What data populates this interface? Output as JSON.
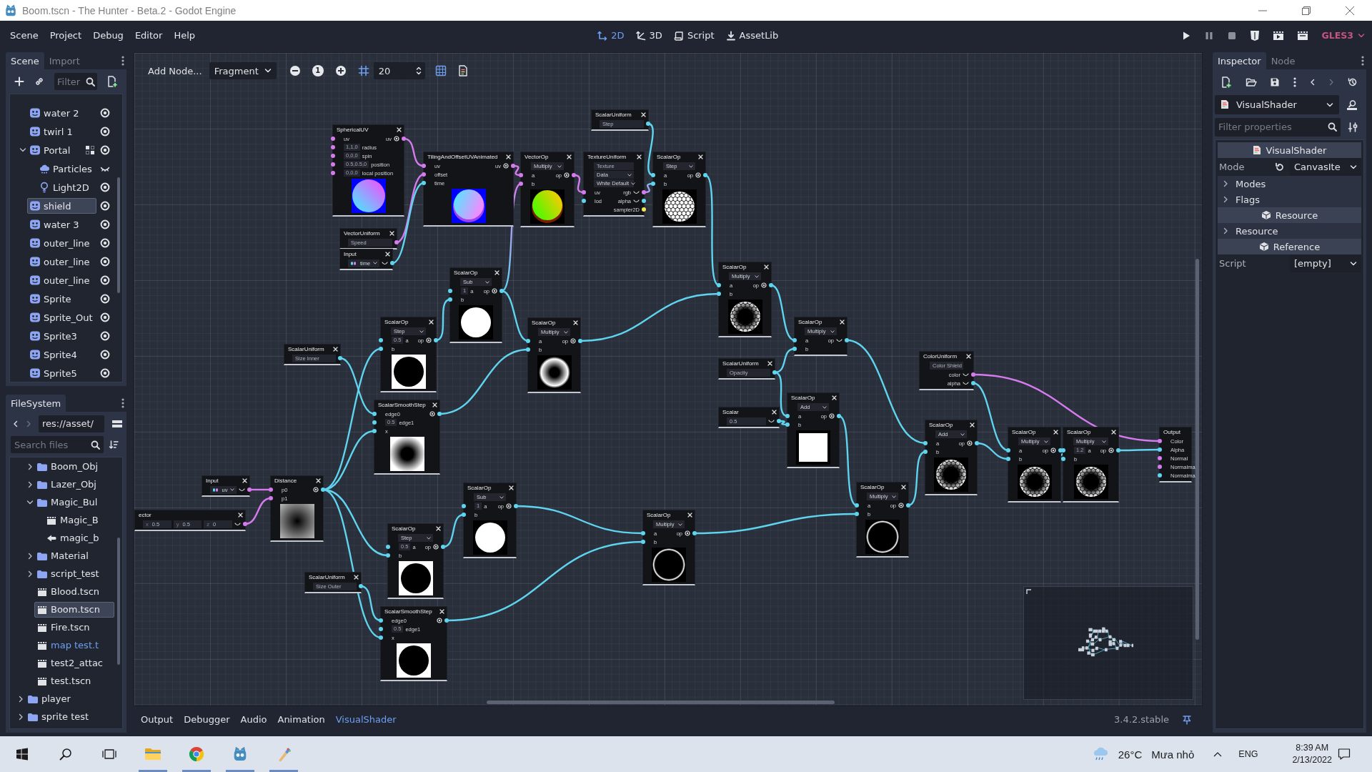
{
  "window": {
    "title": "Boom.tscn - The Hunter - Beta.2 - Godot Engine"
  },
  "menu": [
    "Scene",
    "Project",
    "Debug",
    "Editor",
    "Help"
  ],
  "workspaces": [
    {
      "label": "2D",
      "kind": "canvas",
      "selected": true
    },
    {
      "label": "3D",
      "kind": "spatial",
      "selected": false
    },
    {
      "label": "Script",
      "kind": "script",
      "selected": false
    },
    {
      "label": "AssetLib",
      "kind": "assetlib",
      "selected": false
    }
  ],
  "run_buttons": [
    {
      "kind": "play",
      "disabled": false
    },
    {
      "kind": "pause",
      "disabled": true
    },
    {
      "kind": "stop",
      "disabled": true
    },
    {
      "kind": "html5",
      "disabled": false
    },
    {
      "kind": "playscene",
      "disabled": false
    },
    {
      "kind": "playcustom",
      "disabled": false
    }
  ],
  "renderer": "GLES3",
  "scene_dock": {
    "tabs": [
      {
        "label": "Scene",
        "selected": true
      },
      {
        "label": "Import",
        "selected": false
      }
    ],
    "filter": {
      "placeholder": "Filter"
    },
    "tree": [
      {
        "label": "water 2",
        "kind": "sprite",
        "in_group": false,
        "visible": true,
        "selected": false
      },
      {
        "label": "twirl 1",
        "kind": "sprite",
        "in_group": false,
        "visible": true,
        "selected": false
      },
      {
        "label": "Portal",
        "kind": "sprite",
        "in_group": true,
        "visible": true,
        "selected": false,
        "expanded": true,
        "children": [
          {
            "label": "Particles",
            "kind": "particles",
            "in_group": false,
            "visible": false,
            "selected": false
          },
          {
            "label": "Light2D",
            "kind": "light",
            "in_group": false,
            "visible": true,
            "selected": false
          }
        ]
      },
      {
        "label": "shield",
        "kind": "sprite",
        "in_group": false,
        "visible": true,
        "selected": true
      },
      {
        "label": "water 3",
        "kind": "sprite",
        "in_group": false,
        "visible": true,
        "selected": false
      },
      {
        "label": "outer_line",
        "kind": "sprite",
        "in_group": false,
        "visible": true,
        "selected": false
      },
      {
        "label": "outer_line",
        "kind": "sprite",
        "in_group": false,
        "visible": true,
        "selected": false
      },
      {
        "label": "outer_line",
        "kind": "sprite",
        "in_group": false,
        "visible": true,
        "selected": false
      },
      {
        "label": "Sprite",
        "kind": "sprite",
        "in_group": false,
        "visible": true,
        "selected": false
      },
      {
        "label": "Sprite_Out",
        "kind": "sprite",
        "in_group": false,
        "visible": true,
        "selected": false
      },
      {
        "label": "Sprite3",
        "kind": "sprite",
        "in_group": false,
        "visible": true,
        "selected": false
      },
      {
        "label": "Sprite4",
        "kind": "sprite",
        "in_group": false,
        "visible": true,
        "selected": false
      },
      {
        "label": "Sprite5",
        "kind": "sprite",
        "in_group": false,
        "visible": true,
        "selected": false
      }
    ]
  },
  "filesystem_dock": {
    "tabs": [
      {
        "label": "FileSystem",
        "selected": true
      }
    ],
    "path": "res://asset/",
    "search": {
      "placeholder": "Search files"
    },
    "tree": [
      {
        "children": [
          {
            "label": "Boom_Obj",
            "kind": "folder",
            "expanded": false,
            "selected": false,
            "highlighted": false
          },
          {
            "label": "Lazer_Obj",
            "kind": "folder",
            "expanded": false,
            "selected": false,
            "highlighted": false
          },
          {
            "label": "Magic_Bul",
            "kind": "folder",
            "expanded": true,
            "selected": false,
            "highlighted": false,
            "children": [
              {
                "label": "Magic_B",
                "kind": "scene",
                "selected": false,
                "highlighted": false
              },
              {
                "label": "magic_b",
                "kind": "resource",
                "selected": false,
                "highlighted": false
              }
            ]
          },
          {
            "label": "Material",
            "kind": "folder",
            "expanded": false,
            "selected": false,
            "highlighted": false
          },
          {
            "label": "script_test",
            "kind": "folder",
            "expanded": false,
            "selected": false,
            "highlighted": false
          },
          {
            "label": "Blood.tscn",
            "kind": "scene",
            "selected": false,
            "highlighted": false
          },
          {
            "label": "Boom.tscn",
            "kind": "scene",
            "selected": true,
            "highlighted": false
          },
          {
            "label": "Fire.tscn",
            "kind": "scene",
            "selected": false,
            "highlighted": false
          },
          {
            "label": "map test.t",
            "kind": "scene",
            "selected": false,
            "highlighted": true
          },
          {
            "label": "test2_attac",
            "kind": "scene",
            "selected": false,
            "highlighted": false
          },
          {
            "label": "test.tscn",
            "kind": "scene",
            "selected": false,
            "highlighted": false
          }
        ]
      },
      {
        "label": "player",
        "kind": "folder",
        "expanded": false,
        "selected": false,
        "highlighted": false
      },
      {
        "label": "sprite test",
        "kind": "folder",
        "expanded": false,
        "selected": false,
        "highlighted": false
      }
    ]
  },
  "graph": {
    "toolbar": {
      "add_node": "Add Node...",
      "shader_type": "Fragment",
      "zoom_reset": "1",
      "snap_on": true,
      "snap_step": "20",
      "minimap_on": true
    },
    "nodes": [
      {
        "title": "ScalarUniform",
        "closable": true,
        "rows": [
          {
            "items": [
              {
                "kind": "field",
                "value": "Step"
              }
            ],
            "out": {
              "kind": "scalar"
            }
          }
        ]
      },
      {
        "title": "SphericalUV",
        "closable": true,
        "rows": [
          {
            "in": {
              "kind": "vector",
              "label": "uv"
            },
            "out": {
              "kind": "vector",
              "label": "uv",
              "preview": true
            }
          },
          {
            "in": {
              "kind": "vector",
              "label": "radius",
              "value": "1,1,0"
            }
          },
          {
            "in": {
              "kind": "vector",
              "label": "spin",
              "value": "0,0,0"
            }
          },
          {
            "in": {
              "kind": "vector",
              "label": "position",
              "value": "0.5,0.5,0"
            }
          },
          {
            "in": {
              "kind": "vector",
              "label": "local position",
              "value": "0,0,0"
            }
          }
        ],
        "preview": {
          "kind": "uvsphere"
        }
      },
      {
        "title": "TilingAndOffsetUVAnimated",
        "closable": true,
        "rows": [
          {
            "in": {
              "kind": "vector",
              "label": "uv"
            },
            "out": {
              "kind": "vector",
              "label": "uv",
              "preview": true
            }
          },
          {
            "in": {
              "kind": "vector",
              "label": "offset"
            }
          },
          {
            "in": {
              "kind": "scalar",
              "label": "time"
            }
          }
        ],
        "preview": {
          "kind": "tiledsphere"
        }
      },
      {
        "title": "VectorOp",
        "closable": true,
        "controls": [
          {
            "kind": "dropdown",
            "value": "Multiply"
          }
        ],
        "rows": [
          {
            "in": {
              "kind": "vector",
              "label": "a"
            },
            "out": {
              "kind": "vector",
              "label": "op",
              "preview": true
            }
          },
          {
            "in": {
              "kind": "vector",
              "label": "b"
            }
          }
        ],
        "preview": {
          "kind": "colorsphere"
        }
      },
      {
        "title": "TextureUniform",
        "closable": true,
        "controls": [
          {
            "kind": "field",
            "value": "Texture"
          },
          {
            "kind": "dropdown",
            "value": "Data"
          },
          {
            "kind": "dropdown",
            "value": "White Default"
          }
        ],
        "rows": [
          {
            "in": {
              "kind": "vector",
              "label": "uv"
            },
            "out": {
              "kind": "vector",
              "label": "rgb",
              "preview": false
            }
          },
          {
            "in": {
              "kind": "scalar",
              "label": "lod"
            },
            "out": {
              "kind": "scalar",
              "label": "alpha",
              "preview": false
            }
          },
          {
            "out": {
              "kind": "sampler",
              "label": "sampler2D"
            }
          }
        ]
      },
      {
        "title": "ScalarOp",
        "closable": true,
        "controls": [
          {
            "kind": "dropdown",
            "value": "Step"
          }
        ],
        "rows": [
          {
            "in": {
              "kind": "scalar",
              "label": "a"
            },
            "out": {
              "kind": "scalar",
              "label": "op",
              "preview": true
            }
          },
          {
            "in": {
              "kind": "scalar",
              "label": "b"
            }
          }
        ],
        "preview": {
          "kind": "hexsphere"
        }
      },
      {
        "title": "VectorUniform",
        "closable": true,
        "rows": [
          {
            "items": [
              {
                "kind": "field",
                "value": "Speed"
              }
            ],
            "out": {
              "kind": "vector"
            }
          }
        ]
      },
      {
        "title": "Input",
        "closable": true,
        "rows": [
          {
            "items": [
              {
                "kind": "input",
                "value": "time"
              }
            ],
            "out": {
              "kind": "scalar",
              "preview": false
            }
          }
        ]
      },
      {
        "title": "ScalarOp",
        "closable": true,
        "controls": [
          {
            "kind": "dropdown",
            "value": "Sub"
          }
        ],
        "rows": [
          {
            "in": {
              "kind": "scalar",
              "label": "a",
              "value": "1"
            },
            "out": {
              "kind": "scalar",
              "label": "op",
              "preview": true
            }
          },
          {
            "in": {
              "kind": "scalar",
              "label": "b"
            }
          }
        ],
        "preview": {
          "kind": "whitedisc"
        }
      },
      {
        "title": "ScalarOp",
        "closable": true,
        "controls": [
          {
            "kind": "dropdown",
            "value": "Multiply"
          }
        ],
        "rows": [
          {
            "in": {
              "kind": "scalar",
              "label": "a"
            },
            "out": {
              "kind": "scalar",
              "label": "op",
              "preview": true
            }
          },
          {
            "in": {
              "kind": "scalar",
              "label": "b"
            }
          }
        ],
        "preview": {
          "kind": "hexring"
        }
      },
      {
        "title": "ScalarUniform",
        "closable": true,
        "rows": [
          {
            "items": [
              {
                "kind": "field",
                "value": "Size Inner"
              }
            ],
            "out": {
              "kind": "scalar"
            }
          }
        ]
      },
      {
        "title": "ScalarOp",
        "closable": true,
        "controls": [
          {
            "kind": "dropdown",
            "value": "Step"
          }
        ],
        "rows": [
          {
            "in": {
              "kind": "scalar",
              "label": "a",
              "value": "0.5"
            },
            "out": {
              "kind": "scalar",
              "label": "op",
              "preview": true
            }
          },
          {
            "in": {
              "kind": "scalar",
              "label": "b"
            }
          }
        ],
        "preview": {
          "kind": "blackdisc"
        }
      },
      {
        "title": "ScalarOp",
        "closable": true,
        "controls": [
          {
            "kind": "dropdown",
            "value": "Multiply"
          }
        ],
        "rows": [
          {
            "in": {
              "kind": "scalar",
              "label": "a"
            },
            "out": {
              "kind": "scalar",
              "label": "op",
              "preview": true
            }
          },
          {
            "in": {
              "kind": "scalar",
              "label": "b"
            }
          }
        ],
        "preview": {
          "kind": "softring"
        }
      },
      {
        "title": "ScalarOp",
        "closable": true,
        "controls": [
          {
            "kind": "dropdown",
            "value": "Multiply"
          }
        ],
        "rows": [
          {
            "in": {
              "kind": "scalar",
              "label": "a"
            },
            "out": {
              "kind": "scalar",
              "label": "op",
              "preview": false
            }
          },
          {
            "in": {
              "kind": "scalar",
              "label": "b"
            }
          }
        ]
      },
      {
        "title": "ScalarUniform",
        "closable": true,
        "rows": [
          {
            "items": [
              {
                "kind": "field",
                "value": "Opacity"
              }
            ],
            "out": {
              "kind": "scalar"
            }
          }
        ]
      },
      {
        "title": "ColorUniform",
        "closable": true,
        "controls": [
          {
            "kind": "field",
            "value": "Color Shield"
          }
        ],
        "rows": [
          {
            "out": {
              "kind": "vector",
              "label": "color",
              "preview": false
            }
          },
          {
            "out": {
              "kind": "scalar",
              "label": "alpha",
              "preview": false
            }
          }
        ]
      },
      {
        "title": "ScalarSmoothStep",
        "closable": true,
        "rows": [
          {
            "in": {
              "kind": "scalar",
              "label": "edge0"
            },
            "out": {
              "kind": "scalar",
              "preview": true
            }
          },
          {
            "in": {
              "kind": "scalar",
              "label": "edge1",
              "value": "0.5"
            }
          },
          {
            "in": {
              "kind": "scalar",
              "label": "x"
            }
          }
        ],
        "preview": {
          "kind": "softdisc"
        }
      },
      {
        "title": "Scalar",
        "closable": true,
        "rows": [
          {
            "items": [
              {
                "kind": "field",
                "value": "0.5"
              }
            ],
            "out": {
              "kind": "scalar",
              "preview": false
            }
          }
        ]
      },
      {
        "title": "ScalarOp",
        "closable": true,
        "controls": [
          {
            "kind": "dropdown",
            "value": "Add"
          }
        ],
        "rows": [
          {
            "in": {
              "kind": "scalar",
              "label": "a"
            },
            "out": {
              "kind": "scalar",
              "label": "op",
              "preview": true
            }
          },
          {
            "in": {
              "kind": "scalar",
              "label": "b"
            }
          }
        ],
        "preview": {
          "kind": "whitesquare"
        }
      },
      {
        "title": "ScalarOp",
        "closable": true,
        "controls": [
          {
            "kind": "dropdown",
            "value": "Add"
          }
        ],
        "rows": [
          {
            "in": {
              "kind": "scalar",
              "label": "a"
            },
            "out": {
              "kind": "scalar",
              "label": "op",
              "preview": true
            }
          },
          {
            "in": {
              "kind": "scalar",
              "label": "b"
            }
          }
        ],
        "preview": {
          "kind": "hexring"
        }
      },
      {
        "title": "ScalarOp",
        "closable": true,
        "controls": [
          {
            "kind": "dropdown",
            "value": "Multiply"
          }
        ],
        "rows": [
          {
            "in": {
              "kind": "scalar",
              "label": "a"
            },
            "out": {
              "kind": "scalar",
              "label": "op",
              "preview": true
            }
          },
          {
            "in": {
              "kind": "scalar",
              "label": "b"
            }
          }
        ],
        "preview": {
          "kind": "hexring"
        }
      },
      {
        "title": "ScalarOp",
        "closable": true,
        "controls": [
          {
            "kind": "dropdown",
            "value": "Multiply"
          }
        ],
        "rows": [
          {
            "in": {
              "kind": "scalar",
              "label": "a",
              "value": "1.2"
            },
            "out": {
              "kind": "scalar",
              "label": "op",
              "preview": true
            }
          },
          {
            "in": {
              "kind": "scalar",
              "label": "b"
            }
          }
        ],
        "preview": {
          "kind": "hexring"
        }
      },
      {
        "title": "Output",
        "closable": false,
        "rows": [
          {
            "in": {
              "kind": "vector",
              "label": "Color"
            }
          },
          {
            "in": {
              "kind": "scalar",
              "label": "Alpha"
            }
          },
          {
            "in": {
              "kind": "vector",
              "label": "Normal"
            }
          },
          {
            "in": {
              "kind": "vector",
              "label": "Normalma"
            }
          },
          {
            "in": {
              "kind": "scalar",
              "label": "Normalma"
            }
          }
        ]
      },
      {
        "title": "Input",
        "closable": true,
        "rows": [
          {
            "items": [
              {
                "kind": "input",
                "value": "uv"
              }
            ],
            "out": {
              "kind": "vector",
              "preview": false
            }
          }
        ]
      },
      {
        "title": "ector",
        "closable": true,
        "rows": [
          {
            "items": [
              {
                "kind": "field",
                "label": "x",
                "value": "0.5"
              },
              {
                "kind": "field",
                "label": "y",
                "value": "0.5"
              },
              {
                "kind": "field",
                "label": "z",
                "value": "0"
              }
            ],
            "out": {
              "kind": "vector",
              "preview": false
            }
          }
        ]
      },
      {
        "title": "Distance",
        "closable": true,
        "rows": [
          {
            "in": {
              "kind": "vector",
              "label": "p0"
            },
            "out": {
              "kind": "scalar",
              "preview": true
            }
          },
          {
            "in": {
              "kind": "vector",
              "label": "p1"
            }
          }
        ],
        "preview": {
          "kind": "distance"
        }
      },
      {
        "title": "ScalarOp",
        "closable": true,
        "controls": [
          {
            "kind": "dropdown",
            "value": "Sub"
          }
        ],
        "rows": [
          {
            "in": {
              "kind": "scalar",
              "label": "a",
              "value": "1"
            },
            "out": {
              "kind": "scalar",
              "label": "op",
              "preview": true
            }
          },
          {
            "in": {
              "kind": "scalar",
              "label": "b"
            }
          }
        ],
        "preview": {
          "kind": "whitedisc"
        }
      },
      {
        "title": "ScalarOp",
        "closable": true,
        "controls": [
          {
            "kind": "dropdown",
            "value": "Multiply"
          }
        ],
        "rows": [
          {
            "in": {
              "kind": "scalar",
              "label": "a"
            },
            "out": {
              "kind": "scalar",
              "label": "op",
              "preview": true
            }
          },
          {
            "in": {
              "kind": "scalar",
              "label": "b"
            }
          }
        ],
        "preview": {
          "kind": "ring"
        }
      },
      {
        "title": "ScalarOp",
        "closable": true,
        "controls": [
          {
            "kind": "dropdown",
            "value": "Multiply"
          }
        ],
        "rows": [
          {
            "in": {
              "kind": "scalar",
              "label": "a"
            },
            "out": {
              "kind": "scalar",
              "label": "op",
              "preview": true
            }
          },
          {
            "in": {
              "kind": "scalar",
              "label": "b"
            }
          }
        ],
        "preview": {
          "kind": "ring"
        }
      },
      {
        "title": "ScalarUniform",
        "closable": true,
        "rows": [
          {
            "items": [
              {
                "kind": "field",
                "value": "Size Outer"
              }
            ],
            "out": {
              "kind": "scalar"
            }
          }
        ]
      },
      {
        "title": "ScalarOp",
        "closable": true,
        "controls": [
          {
            "kind": "dropdown",
            "value": "Step"
          }
        ],
        "rows": [
          {
            "in": {
              "kind": "scalar",
              "label": "a",
              "value": "0.5"
            },
            "out": {
              "kind": "scalar",
              "label": "op",
              "preview": true
            }
          },
          {
            "in": {
              "kind": "scalar",
              "label": "b"
            }
          }
        ],
        "preview": {
          "kind": "blackdisc"
        }
      },
      {
        "title": "ScalarSmoothStep",
        "closable": true,
        "rows": [
          {
            "in": {
              "kind": "scalar",
              "label": "edge0"
            },
            "out": {
              "kind": "scalar",
              "preview": true
            }
          },
          {
            "in": {
              "kind": "scalar",
              "label": "edge1",
              "value": "0.5"
            }
          },
          {
            "in": {
              "kind": "scalar",
              "label": "x"
            }
          }
        ],
        "preview": {
          "kind": "blackdisc"
        }
      }
    ]
  },
  "bottom_panel": {
    "tabs": [
      {
        "label": "Output",
        "selected": false
      },
      {
        "label": "Debugger",
        "selected": false
      },
      {
        "label": "Audio",
        "selected": false
      },
      {
        "label": "Animation",
        "selected": false
      },
      {
        "label": "VisualShader",
        "selected": true
      }
    ],
    "version": "3.4.2.stable",
    "pinned": true
  },
  "inspector": {
    "tabs": [
      {
        "label": "Inspector",
        "selected": true
      },
      {
        "label": "Node",
        "selected": false
      }
    ],
    "resource": "VisualShader",
    "filter": {
      "placeholder": "Filter properties"
    },
    "sections": [
      {
        "kind": "classheader",
        "label": "VisualShader"
      },
      {
        "kind": "property",
        "label": "Mode",
        "value": "CanvasIte",
        "revertable": true
      },
      {
        "kind": "group",
        "label": "Modes",
        "expanded": false
      },
      {
        "kind": "group",
        "label": "Flags",
        "expanded": false
      },
      {
        "kind": "header",
        "label": "Resource"
      },
      {
        "kind": "group",
        "label": "Resource",
        "expanded": false
      },
      {
        "kind": "header",
        "label": "Reference"
      },
      {
        "kind": "property",
        "label": "Script",
        "value": "[empty]",
        "revertable": false
      }
    ]
  },
  "taskbar": {
    "apps": [
      {
        "kind": "folder",
        "running": true
      },
      {
        "kind": "browser",
        "running": true
      },
      {
        "kind": "engine",
        "running": true
      },
      {
        "kind": "paint",
        "running": true
      }
    ],
    "weather": {
      "temperature": "26°C",
      "condition": "Mưa nhỏ"
    },
    "language": "ENG",
    "time": "8:39 AM",
    "date": "2/13/2022"
  }
}
